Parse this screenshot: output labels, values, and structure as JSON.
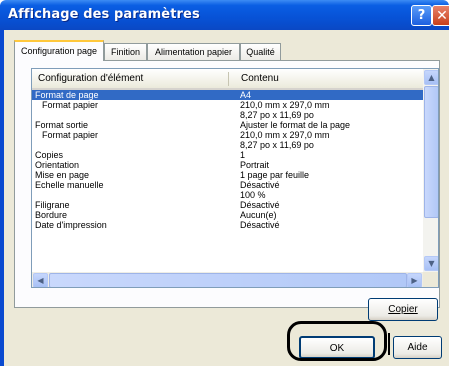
{
  "window": {
    "title": "Affichage des paramètres",
    "help_glyph": "?",
    "close_glyph": "✕"
  },
  "tabs": [
    {
      "label": "Configuration page"
    },
    {
      "label": "Finition"
    },
    {
      "label": "Alimentation papier"
    },
    {
      "label": "Qualité"
    }
  ],
  "list": {
    "headers": {
      "item": "Configuration d'élément",
      "content": "Contenu"
    },
    "rows": [
      {
        "item": "Format de page",
        "content": "A4",
        "selected": true
      },
      {
        "item": "Format papier",
        "content": "210,0 mm x  297,0 mm",
        "indent": true
      },
      {
        "item": "",
        "content": "8,27 po x 11,69 po"
      },
      {
        "item": "Format sortie",
        "content": "Ajuster le format de la page"
      },
      {
        "item": "Format papier",
        "content": "210,0 mm x  297,0 mm",
        "indent": true
      },
      {
        "item": "",
        "content": "8,27 po x 11,69 po"
      },
      {
        "item": "Copies",
        "content": "1"
      },
      {
        "item": "Orientation",
        "content": "Portrait"
      },
      {
        "item": "Mise en page",
        "content": "1 page par feuille"
      },
      {
        "item": "Echelle manuelle",
        "content": "Désactivé"
      },
      {
        "item": "",
        "content": "100 %"
      },
      {
        "item": "Filigrane",
        "content": "Désactivé"
      },
      {
        "item": "Bordure",
        "content": "Aucun(e)"
      },
      {
        "item": "Date d'impression",
        "content": "Désactivé"
      }
    ]
  },
  "buttons": {
    "copy": "Copier",
    "ok": "OK",
    "help": "Aide"
  }
}
